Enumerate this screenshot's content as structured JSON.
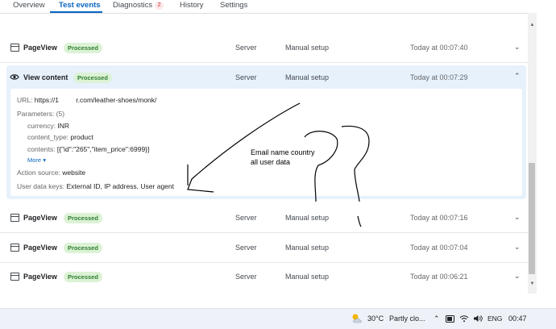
{
  "tabs": [
    {
      "label": "Overview"
    },
    {
      "label": "Test events"
    },
    {
      "label": "Diagnostics",
      "badge": "2"
    },
    {
      "label": "History"
    },
    {
      "label": "Settings"
    }
  ],
  "events": [
    {
      "name": "PageView",
      "status": "Processed",
      "source": "Server",
      "setup": "Manual setup",
      "time": "Today at 00:07:40"
    },
    {
      "name": "View content",
      "status": "Processed",
      "source": "Server",
      "setup": "Manual setup",
      "time": "Today at 00:07:29"
    },
    {
      "name": "PageView",
      "status": "Processed",
      "source": "Server",
      "setup": "Manual setup",
      "time": "Today at 00:07:16"
    },
    {
      "name": "PageView",
      "status": "Processed",
      "source": "Server",
      "setup": "Manual setup",
      "time": "Today at 00:07:04"
    },
    {
      "name": "PageView",
      "status": "Processed",
      "source": "Server",
      "setup": "Manual setup",
      "time": "Today at 00:06:21"
    }
  ],
  "details": {
    "url_label": "URL:",
    "url_value": "https://1         r.com/leather-shoes/monk/",
    "params_label": "Parameters:",
    "params_count": "(5)",
    "params": [
      {
        "key": "currency:",
        "value": "INR"
      },
      {
        "key": "content_type:",
        "value": "product"
      },
      {
        "key": "contents:",
        "value": "[{\"id\":\"265\",\"item_price\":6999}]"
      }
    ],
    "more": "More",
    "action_source_label": "Action source:",
    "action_source_value": "website",
    "user_data_label": "User data keys:",
    "user_data_value": "External ID, IP address, User agent"
  },
  "annotation": {
    "line1": "Email name country",
    "line2": "all user data"
  },
  "taskbar": {
    "temperature": "30°C",
    "weather": "Partly clo...",
    "language": "ENG",
    "clock": "00:47"
  },
  "icons": [
    "eye-icon",
    "page-icon",
    "chevron-down-icon",
    "chevron-up-icon",
    "weather-icon",
    "wifi-icon",
    "volume-icon",
    "battery-icon"
  ]
}
